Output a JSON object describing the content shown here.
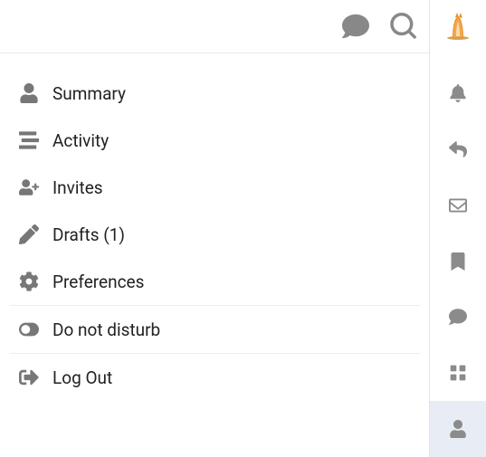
{
  "menu": {
    "summary": "Summary",
    "activity": "Activity",
    "invites": "Invites",
    "drafts": "Drafts (1)",
    "preferences": "Preferences",
    "do_not_disturb": "Do not disturb",
    "log_out": "Log Out"
  }
}
